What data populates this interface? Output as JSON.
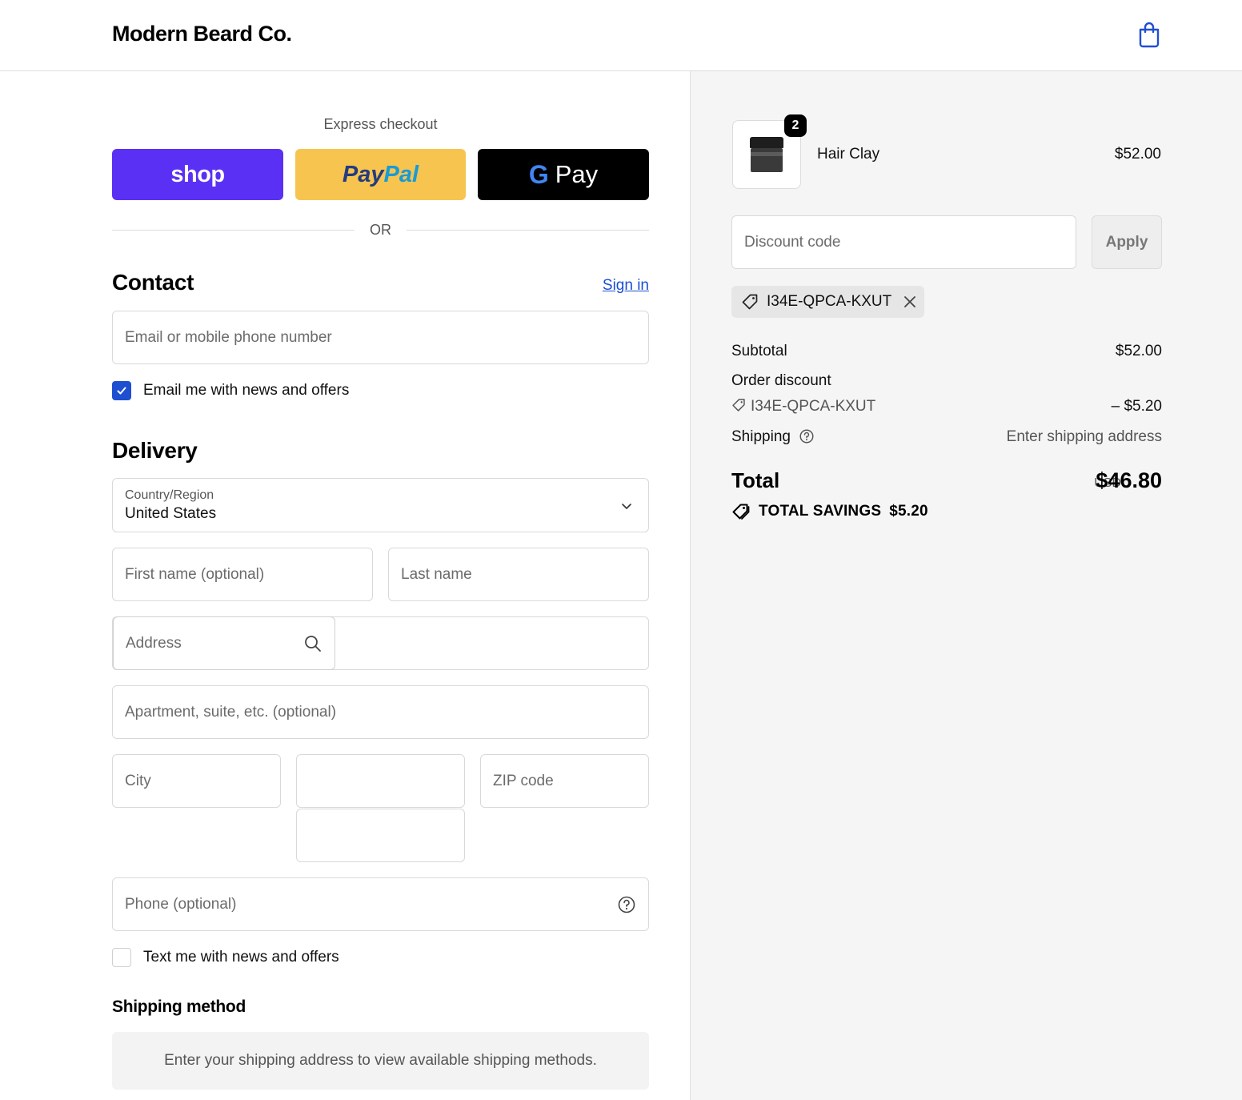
{
  "header": {
    "brand": "Modern Beard Co."
  },
  "express": {
    "title": "Express checkout",
    "shop_label": "shop",
    "paypal_part1": "Pay",
    "paypal_part2": "Pal",
    "gpay_g": "G",
    "gpay_label": "Pay",
    "or_label": "OR"
  },
  "contact": {
    "title": "Contact",
    "signin": "Sign in",
    "email_placeholder": "Email or mobile phone number",
    "news_checkbox": "Email me with news and offers",
    "news_checked": true
  },
  "delivery": {
    "title": "Delivery",
    "country_label": "Country/Region",
    "country_value": "United States",
    "first_name_placeholder": "First name (optional)",
    "last_name_placeholder": "Last name",
    "address_placeholder": "Address",
    "apartment_placeholder": "Apartment, suite, etc. (optional)",
    "city_placeholder": "City",
    "state_placeholder": "",
    "zip_placeholder": "ZIP code",
    "phone_placeholder": "Phone (optional)",
    "text_checkbox": "Text me with news and offers",
    "text_checked": false
  },
  "shipping_method": {
    "title": "Shipping method",
    "info": "Enter your shipping address to view available shipping methods."
  },
  "order": {
    "item": {
      "name": "Hair Clay",
      "price": "$52.00",
      "quantity": "2"
    },
    "discount_placeholder": "Discount code",
    "apply_label": "Apply",
    "applied_code": "I34E-QPCA-KXUT",
    "subtotal_label": "Subtotal",
    "subtotal_value": "$52.00",
    "order_discount_label": "Order discount",
    "discount_code": "I34E-QPCA-KXUT",
    "discount_value": "– $5.20",
    "shipping_label": "Shipping",
    "shipping_value": "Enter shipping address",
    "total_label": "Total",
    "currency": "USD",
    "total_value": "$46.80",
    "savings_label": "TOTAL SAVINGS",
    "savings_value": "$5.20"
  },
  "colors": {
    "shop": "#5a31f4",
    "paypal": "#f6c44f",
    "gpay": "#000000",
    "link": "#1a4fd1",
    "checkbox": "#1f4fd1"
  },
  "icons": {
    "cart": "shopping-bag-icon",
    "discount": "tag-icon",
    "remove": "close-icon",
    "help": "question-circle-icon",
    "search": "search-icon",
    "dropdown": "chevron-down-icon",
    "check": "check-icon"
  }
}
